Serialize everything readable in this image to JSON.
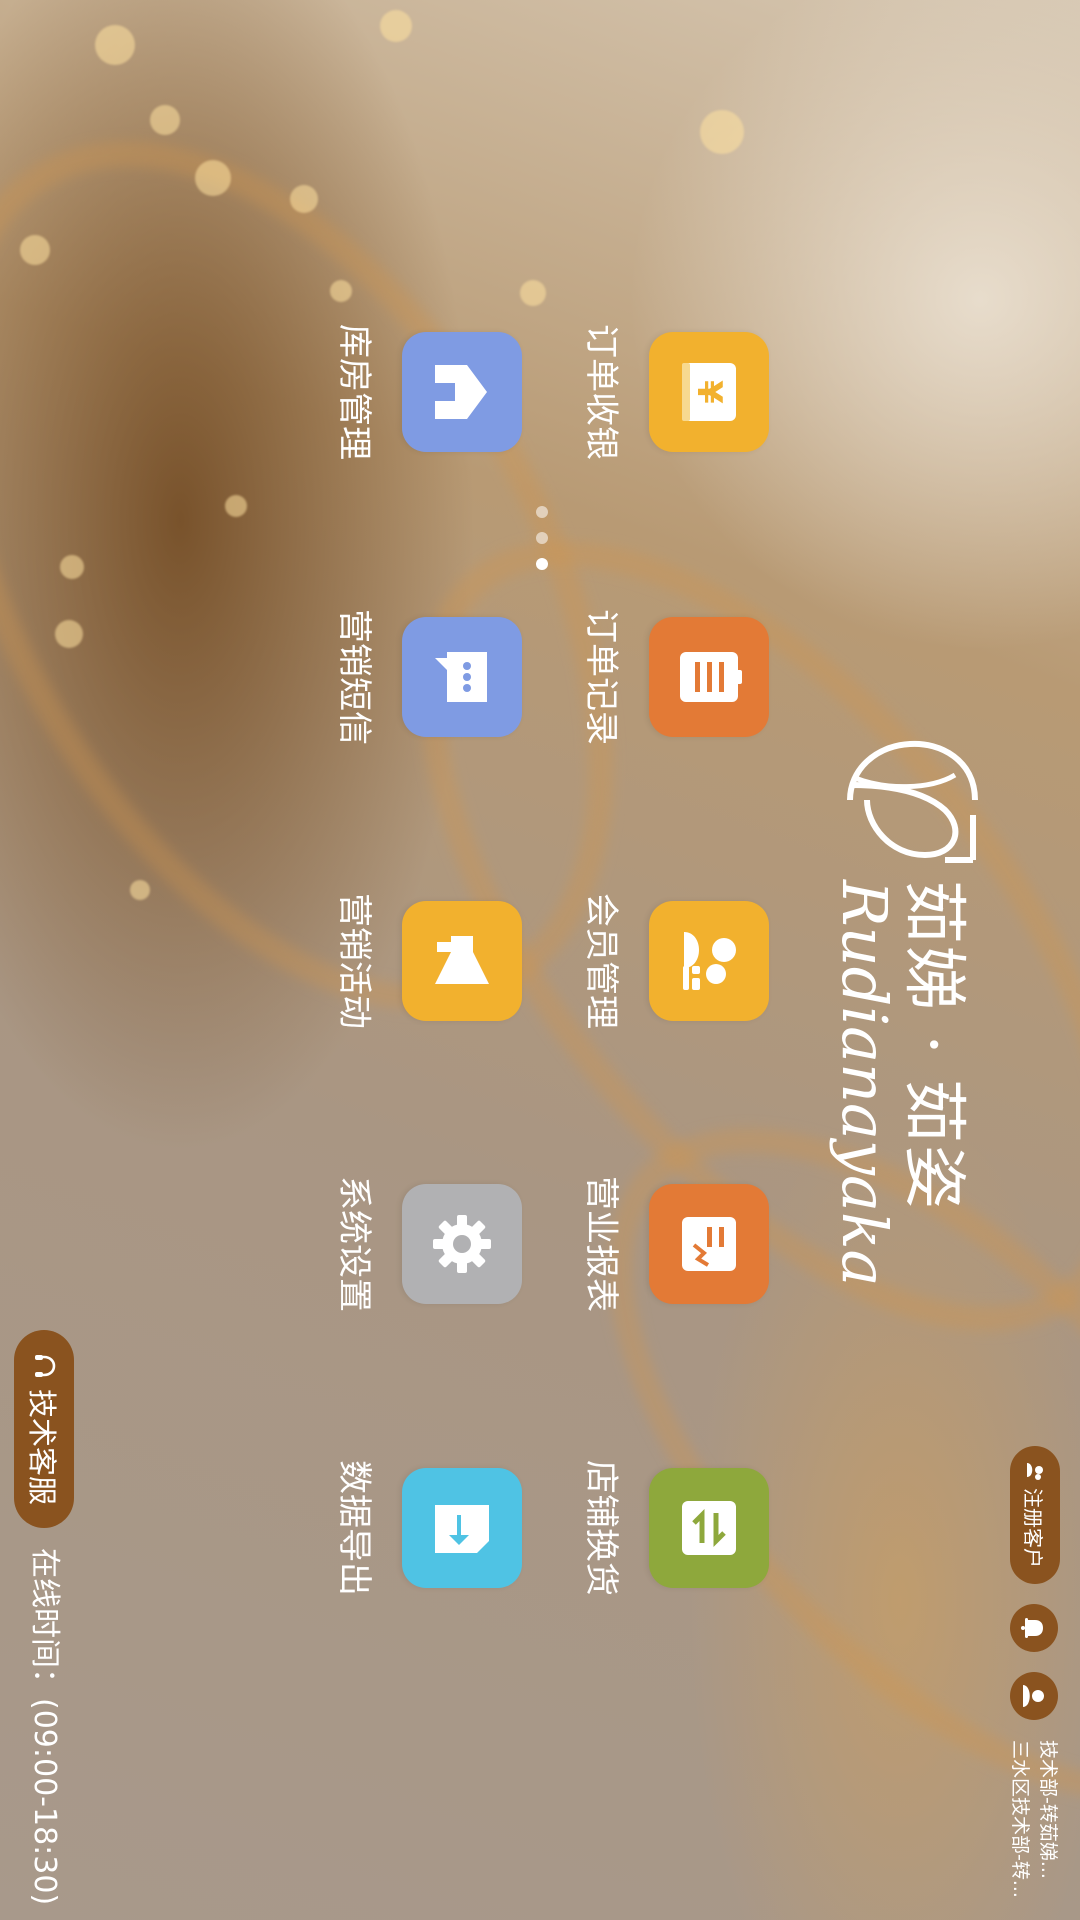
{
  "brand": {
    "name_cn": "茹娣 · 茹姿",
    "name_en": "Rudianayaka"
  },
  "tiles": [
    {
      "label": "订单收银",
      "icon": "cashier-icon",
      "color": "#f2b12e"
    },
    {
      "label": "订单记录",
      "icon": "order-list-icon",
      "color": "#e37a36"
    },
    {
      "label": "会员管理",
      "icon": "member-icon",
      "color": "#f2b12e"
    },
    {
      "label": "营业报表",
      "icon": "report-icon",
      "color": "#e37a36"
    },
    {
      "label": "店铺换货",
      "icon": "exchange-icon",
      "color": "#8ea83c"
    },
    {
      "label": "库房管理",
      "icon": "warehouse-icon",
      "color": "#7f9be3"
    },
    {
      "label": "营销短信",
      "icon": "sms-icon",
      "color": "#7f9be3"
    },
    {
      "label": "营销活动",
      "icon": "megaphone-icon",
      "color": "#f2b12e"
    },
    {
      "label": "系统设置",
      "icon": "settings-icon",
      "color": "#b1b1b3"
    },
    {
      "label": "数据导出",
      "icon": "export-icon",
      "color": "#4fc3e4"
    }
  ],
  "pagination": {
    "total": 3,
    "active": 3
  },
  "support": {
    "label": "技术客服",
    "icon": "headset-icon"
  },
  "online_time": "在线时间：(09:00-18:30)",
  "top_bar": {
    "register_label": "注册客户",
    "register_icon": "users-icon",
    "notification_icon": "bell-icon",
    "profile_icon": "user-icon",
    "staff_line1": "技术部-转茹娣...",
    "staff_line2": "三水区技术部-转..."
  },
  "accent_color": "#8a531f"
}
